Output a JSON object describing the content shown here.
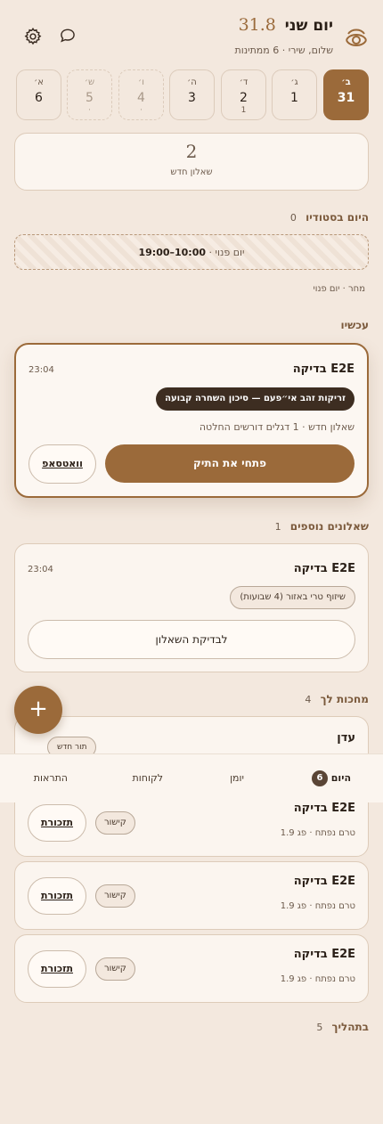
{
  "header": {
    "title": "יום שני",
    "temp": "31.8",
    "subtitle": "שלום, שירי · 6 ממתינות",
    "logo_icon": "eye-logo-icon",
    "settings_icon": "gear-icon",
    "chat_icon": "chat-bubble-icon"
  },
  "days": [
    {
      "letter": "ב׳",
      "num": "31",
      "count": "",
      "selected": true
    },
    {
      "letter": "ג׳",
      "num": "1",
      "count": ""
    },
    {
      "letter": "ד׳",
      "num": "2",
      "count": "1"
    },
    {
      "letter": "ה׳",
      "num": "3",
      "count": ""
    },
    {
      "letter": "ו׳",
      "num": "4",
      "count": "·"
    },
    {
      "letter": "ש׳",
      "num": "5",
      "count": "·"
    },
    {
      "letter": "א׳",
      "num": "6",
      "count": ""
    }
  ],
  "new_questionnaire": {
    "count": "2",
    "label": "שאלון חדש"
  },
  "today_studio": {
    "title": "היום בסטודיו",
    "count": "0",
    "dayoff_label": "יום פנוי ·",
    "dayoff_hours": "10:00–19:00",
    "tomorrow": "מחר · יום פנוי"
  },
  "now": {
    "title": "עכשיו",
    "card": {
      "name": "E2E בדיקה",
      "time": "23:04",
      "tag": "זריקות זהב אי״פעם — סיכון השחרה קבועה",
      "meta": "שאלון חדש · 1 דגלים דורשים החלטה",
      "primary": "פתחי את התיק",
      "whatsapp": "וואטסאפ"
    }
  },
  "more": {
    "title": "שאלונים נוספים",
    "count": "1",
    "card": {
      "name": "E2E בדיקה",
      "time": "23:04",
      "tag": "שיזוף טרי באזור (4 שבועות)",
      "button": "לבדיקת השאלון"
    }
  },
  "waiting": {
    "title": "מחכות לך",
    "count": "4",
    "first": {
      "name": "עדן",
      "tag": "תור חדש"
    },
    "items": [
      {
        "name": "E2E בדיקה",
        "sub": "טרם נפתח · פג 1.9",
        "tag": "קישור",
        "button": "תזכורת"
      },
      {
        "name": "E2E בדיקה",
        "sub": "טרם נפתח · פג 1.9",
        "tag": "קישור",
        "button": "תזכורת"
      },
      {
        "name": "E2E בדיקה",
        "sub": "טרם נפתח · פג 1.9",
        "tag": "קישור",
        "button": "תזכורת"
      }
    ]
  },
  "in_progress": {
    "title": "בתהליך",
    "count": "5"
  },
  "tabs": {
    "today": "היום",
    "today_badge": "6",
    "journal": "יומן",
    "clients": "לקוחות",
    "alerts": "התראות"
  },
  "colors": {
    "accent": "#9b6a3a",
    "background": "#f3e8de",
    "card": "#fbf5ef",
    "dark_pill": "#3d2d21"
  }
}
